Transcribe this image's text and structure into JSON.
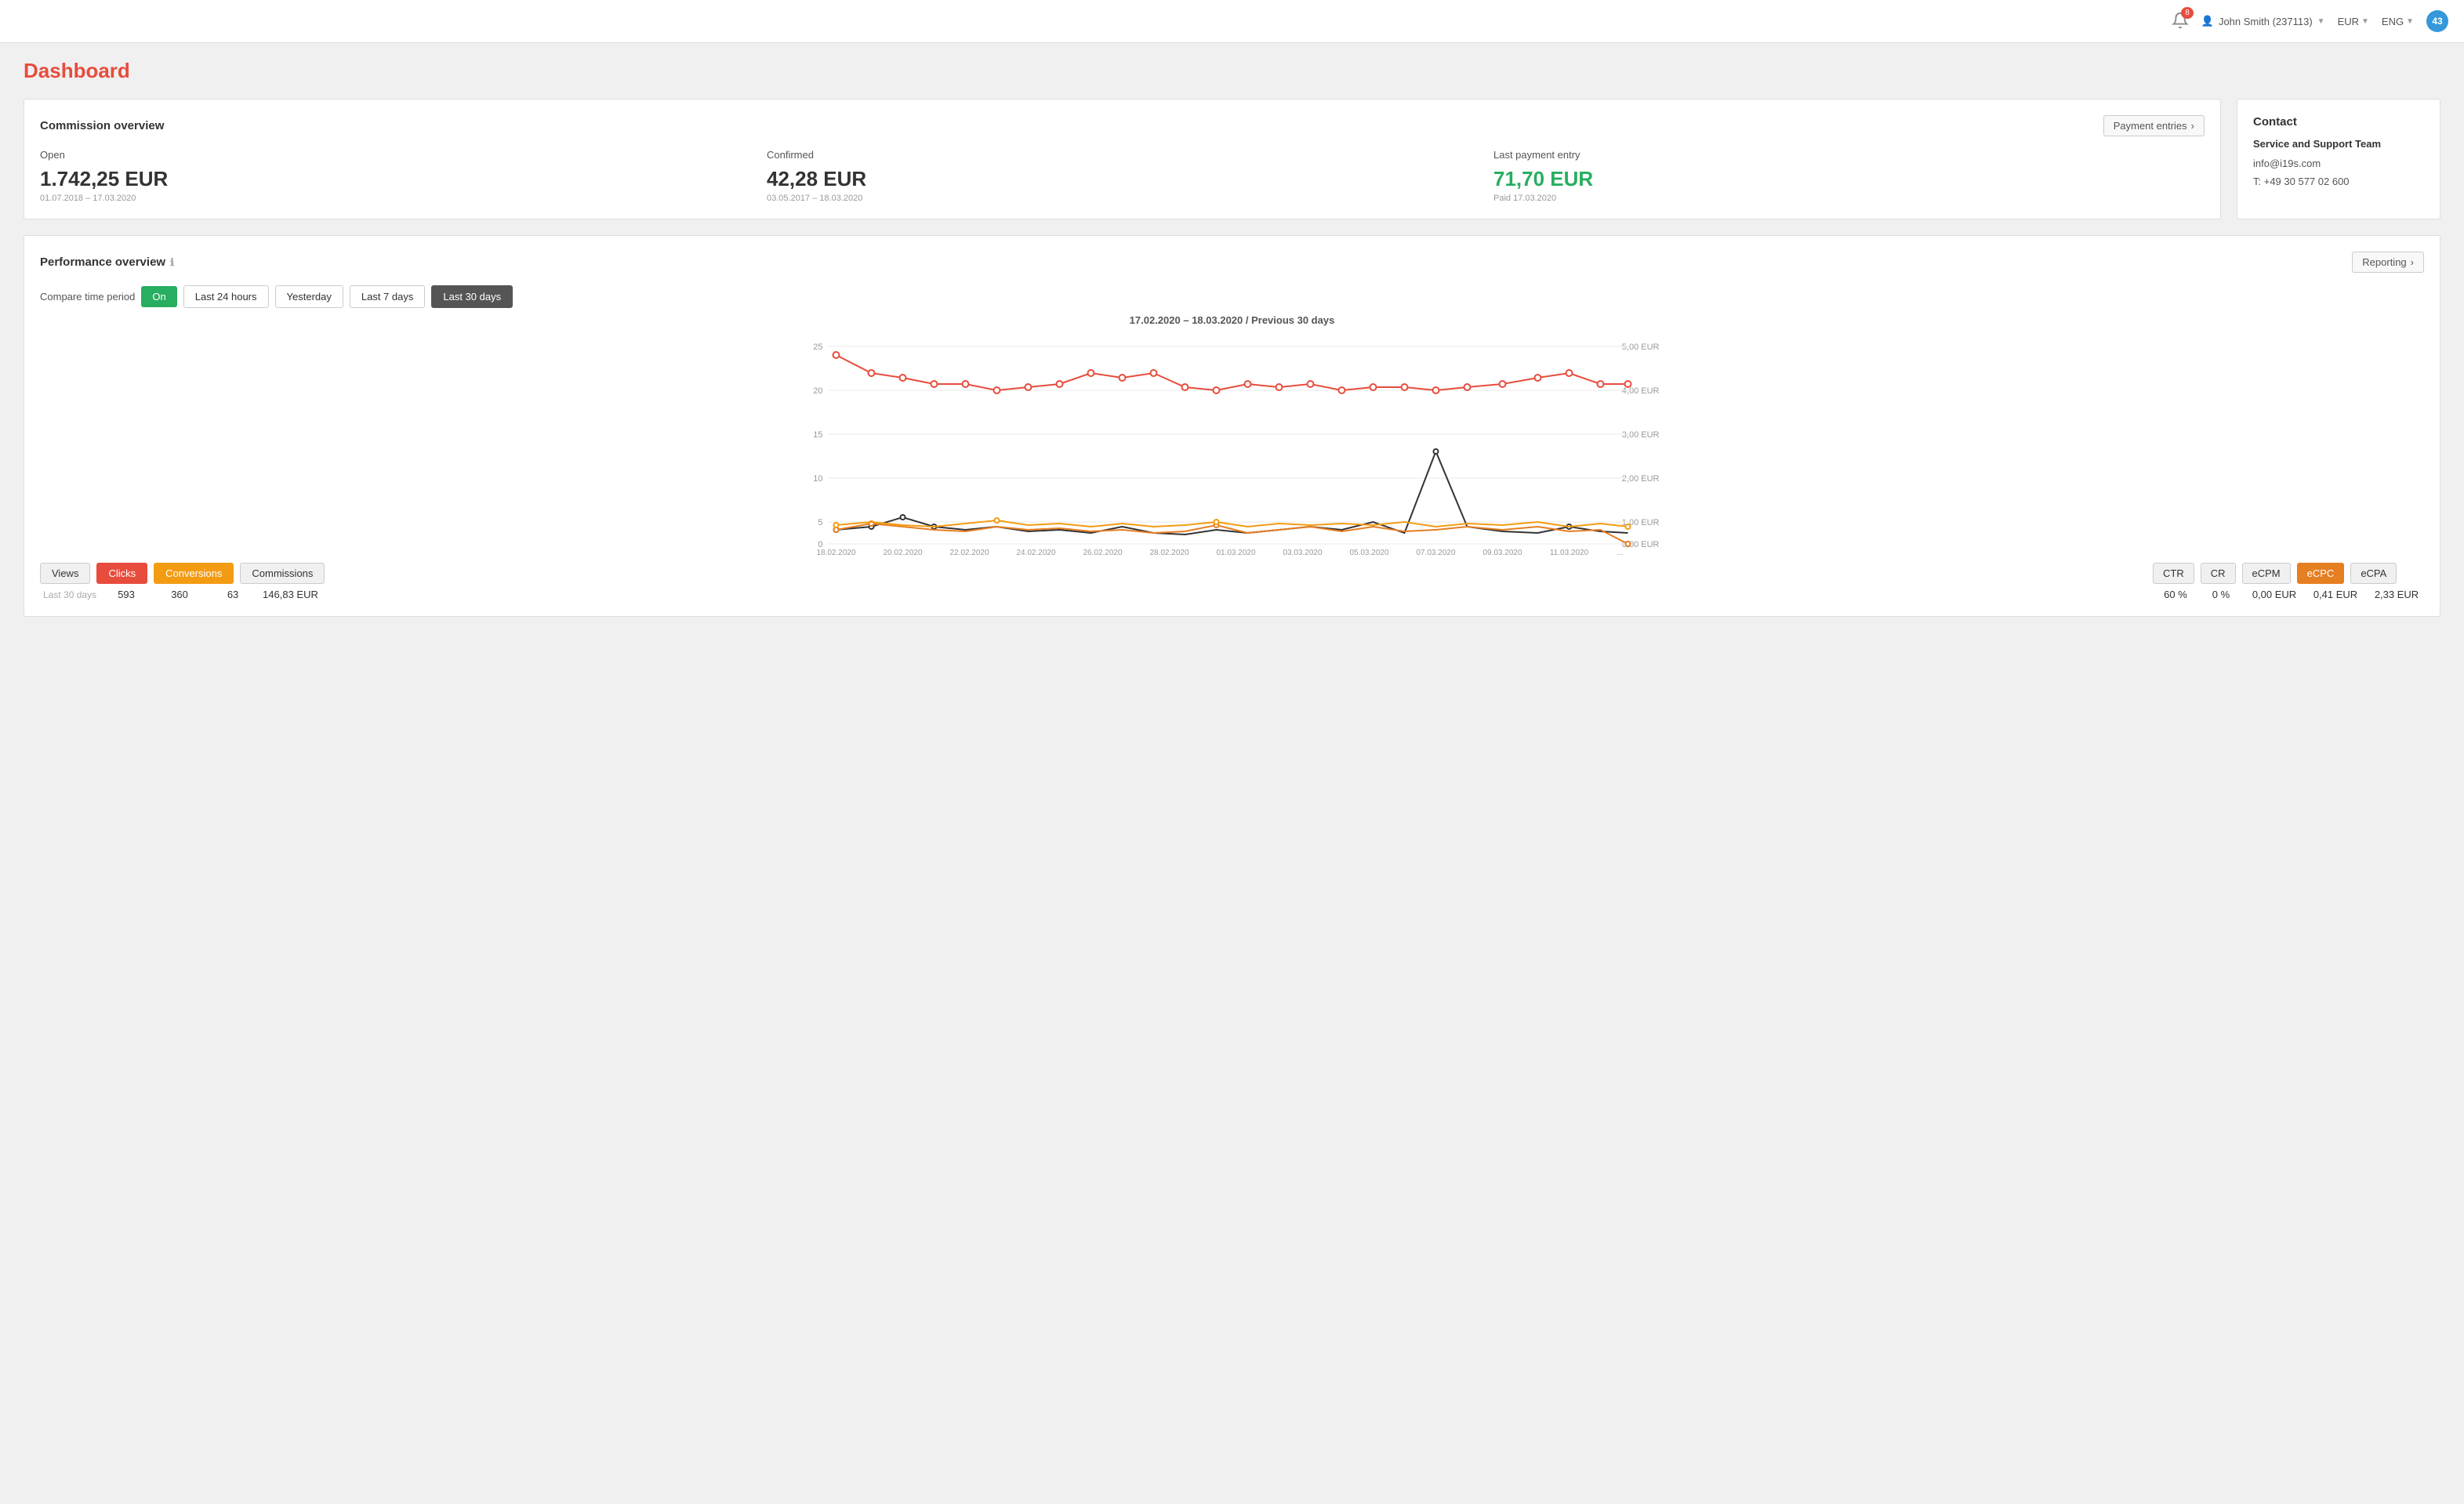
{
  "topbar": {
    "notifications_count": "8",
    "user_name": "John Smith (237113)",
    "currency": "EUR",
    "language": "ENG",
    "avatar_count": "43"
  },
  "page_title": "Dashboard",
  "commission": {
    "section_title": "Commission overview",
    "payment_btn": "Payment entries",
    "open": {
      "label": "Open",
      "value": "1.742,25 EUR",
      "date": "01.07.2018 – 17.03.2020"
    },
    "confirmed": {
      "label": "Confirmed",
      "value": "42,28 EUR",
      "date": "03.05.2017 – 18.03.2020"
    },
    "last_payment": {
      "label": "Last payment entry",
      "value": "71,70 EUR",
      "date": "Paid 17.03.2020"
    }
  },
  "contact": {
    "title": "Contact",
    "team": "Service and Support Team",
    "email": "info@i19s.com",
    "phone": "T: +49 30 577 02 600"
  },
  "performance": {
    "section_title": "Performance overview",
    "reporting_btn": "Reporting",
    "compare_label": "Compare time period",
    "on_btn": "On",
    "time_buttons": [
      "Last 24 hours",
      "Yesterday",
      "Last 7 days",
      "Last 30 days"
    ],
    "active_time": "Last 30 days",
    "date_range": "17.02.2020 – 18.03.2020 / Previous 30 days",
    "legend_buttons": [
      "Views",
      "Clicks",
      "Conversions",
      "Commissions"
    ],
    "active_legend": "Clicks",
    "active_legend2": "Conversions",
    "period_label": "Last 30 days",
    "stats": {
      "views": "593",
      "clicks": "360",
      "conversions": "63",
      "commissions": "146,83 EUR"
    },
    "metrics": {
      "ctr": {
        "label": "CTR",
        "value": "60 %"
      },
      "cr": {
        "label": "CR",
        "value": "0 %"
      },
      "ecpm": {
        "label": "eCPM",
        "value": "0,00 EUR"
      },
      "ecpc": {
        "label": "eCPC",
        "value": "0,41 EUR"
      },
      "ecpa": {
        "label": "eCPA",
        "value": "2,33 EUR"
      }
    }
  }
}
